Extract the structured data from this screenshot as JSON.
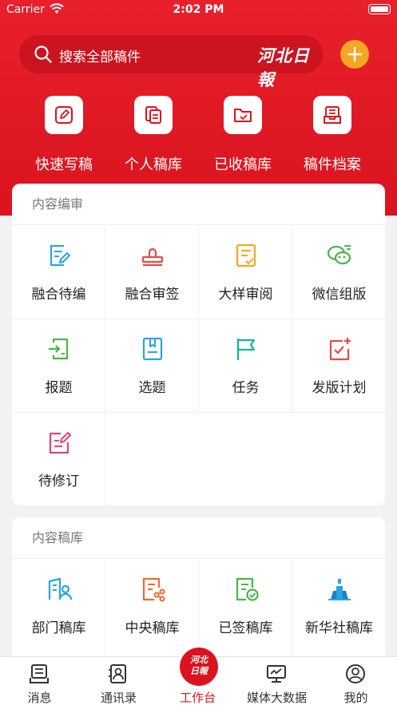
{
  "status": {
    "carrier": "Carrier",
    "time": "2:02 PM"
  },
  "search": {
    "placeholder": "搜索全部稿件",
    "logo": "河北日報"
  },
  "quick_actions": [
    {
      "label": "快速写稿",
      "icon": "edit-icon"
    },
    {
      "label": "个人稿库",
      "icon": "documents-icon"
    },
    {
      "label": "已收稿库",
      "icon": "folder-icon"
    },
    {
      "label": "稿件档案",
      "icon": "archive-icon"
    }
  ],
  "review": {
    "title": "内容编审",
    "items": [
      {
        "label": "融合待编",
        "icon": "edit-doc-icon",
        "color": "#2aa3e6"
      },
      {
        "label": "融合审签",
        "icon": "stamp-icon",
        "color": "#e64a45"
      },
      {
        "label": "大样审阅",
        "icon": "review-doc-icon",
        "color": "#f5a623"
      },
      {
        "label": "微信组版",
        "icon": "wechat-icon",
        "color": "#4cb34e"
      },
      {
        "label": "报题",
        "icon": "import-doc-icon",
        "color": "#4cb34e"
      },
      {
        "label": "选题",
        "icon": "bookmark-doc-icon",
        "color": "#2aa3e6"
      },
      {
        "label": "任务",
        "icon": "flag-icon",
        "color": "#1bb39a"
      },
      {
        "label": "发版计划",
        "icon": "plan-icon",
        "color": "#e64a45"
      },
      {
        "label": "待修订",
        "icon": "revise-icon",
        "color": "#e0457b"
      }
    ]
  },
  "library": {
    "title": "内容稿库",
    "items": [
      {
        "label": "部门稿库",
        "icon": "department-icon",
        "color": "#2aa3e6"
      },
      {
        "label": "中央稿库",
        "icon": "share-doc-icon",
        "color": "#f06a35"
      },
      {
        "label": "已签稿库",
        "icon": "signed-doc-icon",
        "color": "#4cb34e"
      },
      {
        "label": "新华社稿库",
        "icon": "xinhua-icon",
        "color": "#2aa3e6"
      }
    ]
  },
  "tabs": [
    {
      "label": "消息",
      "icon": "message-icon"
    },
    {
      "label": "通讯录",
      "icon": "contacts-icon"
    },
    {
      "label": "工作台",
      "icon": "workbench-logo-icon",
      "active": true,
      "logo_line1": "河北",
      "logo_line2": "日報"
    },
    {
      "label": "媒体大数据",
      "icon": "monitor-chart-icon"
    },
    {
      "label": "我的",
      "icon": "profile-icon"
    }
  ],
  "colors": {
    "brand_red": "#d9141f",
    "accent_orange": "#f5a623"
  }
}
